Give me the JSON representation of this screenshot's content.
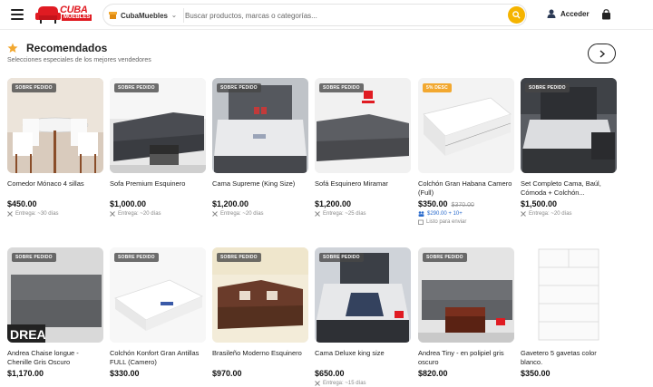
{
  "header": {
    "logo_text": "CUBA",
    "logo_sub": "MUEBLES",
    "store_select": "CubaMuebles",
    "search_placeholder": "Buscar productos, marcas o categorías...",
    "login_label": "Acceder"
  },
  "section": {
    "title": "Recomendados",
    "subtitle": "Selecciones especiales de los mejores vendedores"
  },
  "colors": {
    "accent": "#f5b400",
    "brand": "#e01b22",
    "badge": "#f2a830"
  },
  "products": [
    {
      "badge": "SOBRE PEDIDO",
      "name": "Comedor Mónaco 4 sillas",
      "price": "$450.00",
      "old_price": "",
      "delivery": "Entrega: ~30 días",
      "installment": "",
      "stock": ""
    },
    {
      "badge": "SOBRE PEDIDO",
      "name": "Sofa Premium Esquinero",
      "price": "$1,000.00",
      "old_price": "",
      "delivery": "Entrega: ~20 días",
      "installment": "",
      "stock": ""
    },
    {
      "badge": "SOBRE PEDIDO",
      "name": "Cama Supreme (King Size)",
      "price": "$1,200.00",
      "old_price": "",
      "delivery": "Entrega: ~20 días",
      "installment": "",
      "stock": ""
    },
    {
      "badge": "SOBRE PEDIDO",
      "name": "Sofá Esquinero Miramar",
      "price": "$1,200.00",
      "old_price": "",
      "delivery": "Entrega: ~25 días",
      "installment": "",
      "stock": ""
    },
    {
      "badge": "5% DESC",
      "name": "Colchón Gran Habana Camero (Full)",
      "price": "$350.00",
      "old_price": "$370.00",
      "delivery": "",
      "installment": "$290.00 + 10+",
      "stock": "Listo para enviar"
    },
    {
      "badge": "SOBRE PEDIDO",
      "name": "Set Completo Cama, Baúl, Cómoda + Colchón...",
      "price": "$1,500.00",
      "old_price": "",
      "delivery": "Entrega: ~20 días",
      "installment": "",
      "stock": ""
    },
    {
      "badge": "SOBRE PEDIDO",
      "name": "Andrea Chaise longue - Chenille Gris Oscuro",
      "price": "$1,170.00",
      "old_price": "",
      "delivery": "",
      "installment": "",
      "stock": ""
    },
    {
      "badge": "SOBRE PEDIDO",
      "name": "Colchón Konfort Gran Antillas FULL (Camero)",
      "price": "$330.00",
      "old_price": "",
      "delivery": "",
      "installment": "",
      "stock": ""
    },
    {
      "badge": "SOBRE PEDIDO",
      "name": "Brasileño Moderno Esquinero",
      "price": "$970.00",
      "old_price": "",
      "delivery": "",
      "installment": "",
      "stock": ""
    },
    {
      "badge": "SOBRE PEDIDO",
      "name": "Cama Deluxe king size",
      "price": "$650.00",
      "old_price": "",
      "delivery": "Entrega: ~15 días",
      "installment": "",
      "stock": ""
    },
    {
      "badge": "SOBRE PEDIDO",
      "name": "Andrea Tiny - en polipiel gris oscuro",
      "price": "$820.00",
      "old_price": "",
      "delivery": "",
      "installment": "",
      "stock": ""
    },
    {
      "badge": "",
      "name": "Gavetero 5 gavetas color blanco.",
      "price": "$350.00",
      "old_price": "",
      "delivery": "",
      "installment": "",
      "stock": ""
    }
  ],
  "image_texts": {
    "drea": "DREA"
  }
}
